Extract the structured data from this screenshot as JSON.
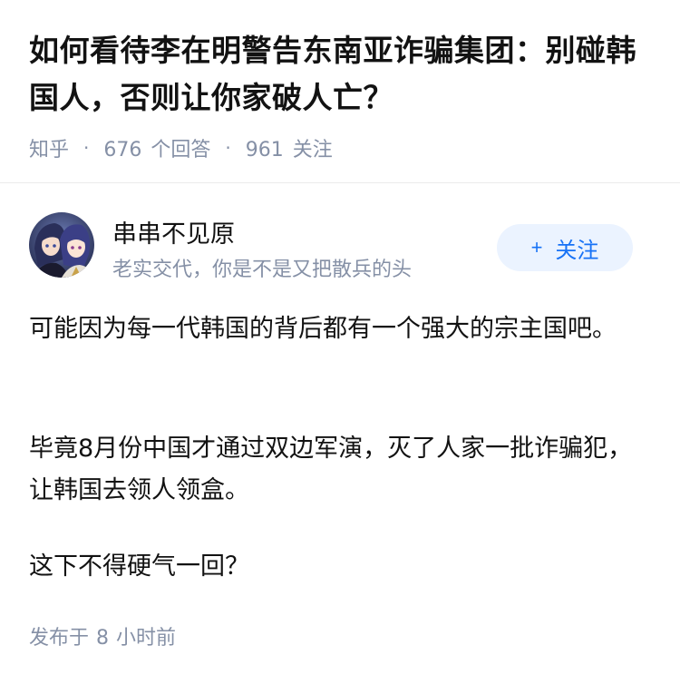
{
  "question": {
    "title": "如何看待李在明警告东南亚诈骗集团：别碰韩国人，否则让你家破人亡？",
    "source": "知乎",
    "answer_count": "676",
    "answer_label": "个回答",
    "follower_count": "961",
    "follower_label": "关注"
  },
  "answer": {
    "author": {
      "name": "串串不见原",
      "bio": "老实交代，你是不是又把散兵的头",
      "avatar_icon": "anime-avatar"
    },
    "follow_button": {
      "plus": "+",
      "label": "关注"
    },
    "paragraphs": [
      "可能因为每一代韩国的背后都有一个强大的宗主国吧。",
      "毕竟8月份中国才通过双边军演，灭了人家一批诈骗犯，让韩国去领人领盒。",
      "这下不得硬气一回？"
    ],
    "published": {
      "prefix": "发布于",
      "value": "8",
      "unit": "小时前"
    }
  },
  "colors": {
    "accent": "#1772f6",
    "button_bg": "#ebf3ff",
    "meta": "#8590a6",
    "text": "#121212"
  }
}
